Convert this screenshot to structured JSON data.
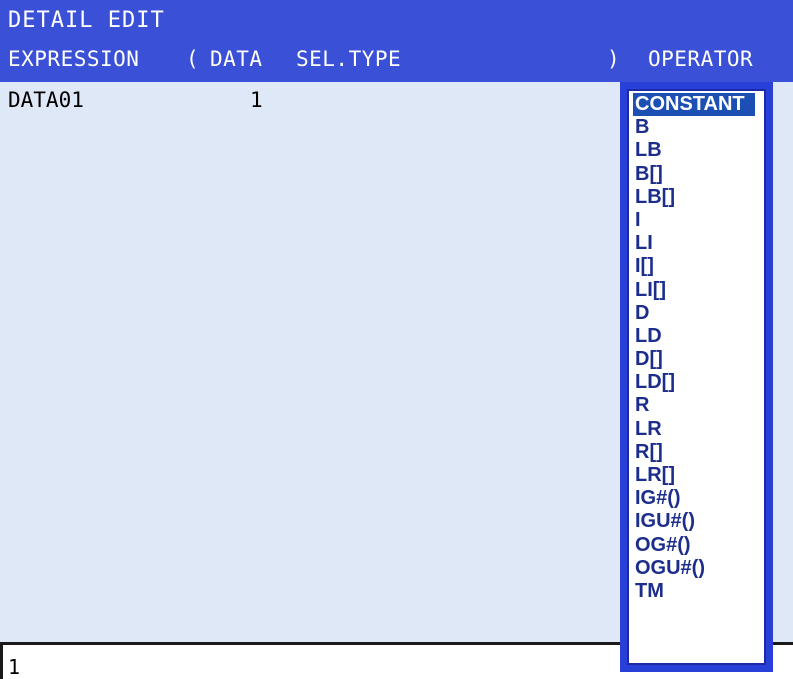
{
  "header": {
    "title": "DETAIL EDIT",
    "columns": {
      "expression": "EXPRESSION",
      "open_paren": "(",
      "data": "DATA",
      "sel_type": "SEL.TYPE",
      "close_paren": ")",
      "operator": "OPERATOR"
    }
  },
  "row": {
    "name": "DATA01",
    "value": "1"
  },
  "input": {
    "value": "1"
  },
  "operator_menu": {
    "selected": "CONSTANT",
    "items": [
      "CONSTANT",
      "B",
      "LB",
      "B[]",
      "LB[]",
      "I",
      "LI",
      "I[]",
      "LI[]",
      "D",
      "LD",
      "D[]",
      "LD[]",
      "R",
      "LR",
      "R[]",
      "LR[]",
      "IG#()",
      "IGU#()",
      "OG#()",
      "OGU#()",
      "TM"
    ]
  },
  "colors": {
    "header_bg": "#3a50d6",
    "content_bg": "#dfe8f6",
    "menu_border": "#2840d8",
    "menu_text": "#1c2d8c",
    "selected_bg": "#1c4fb3"
  }
}
